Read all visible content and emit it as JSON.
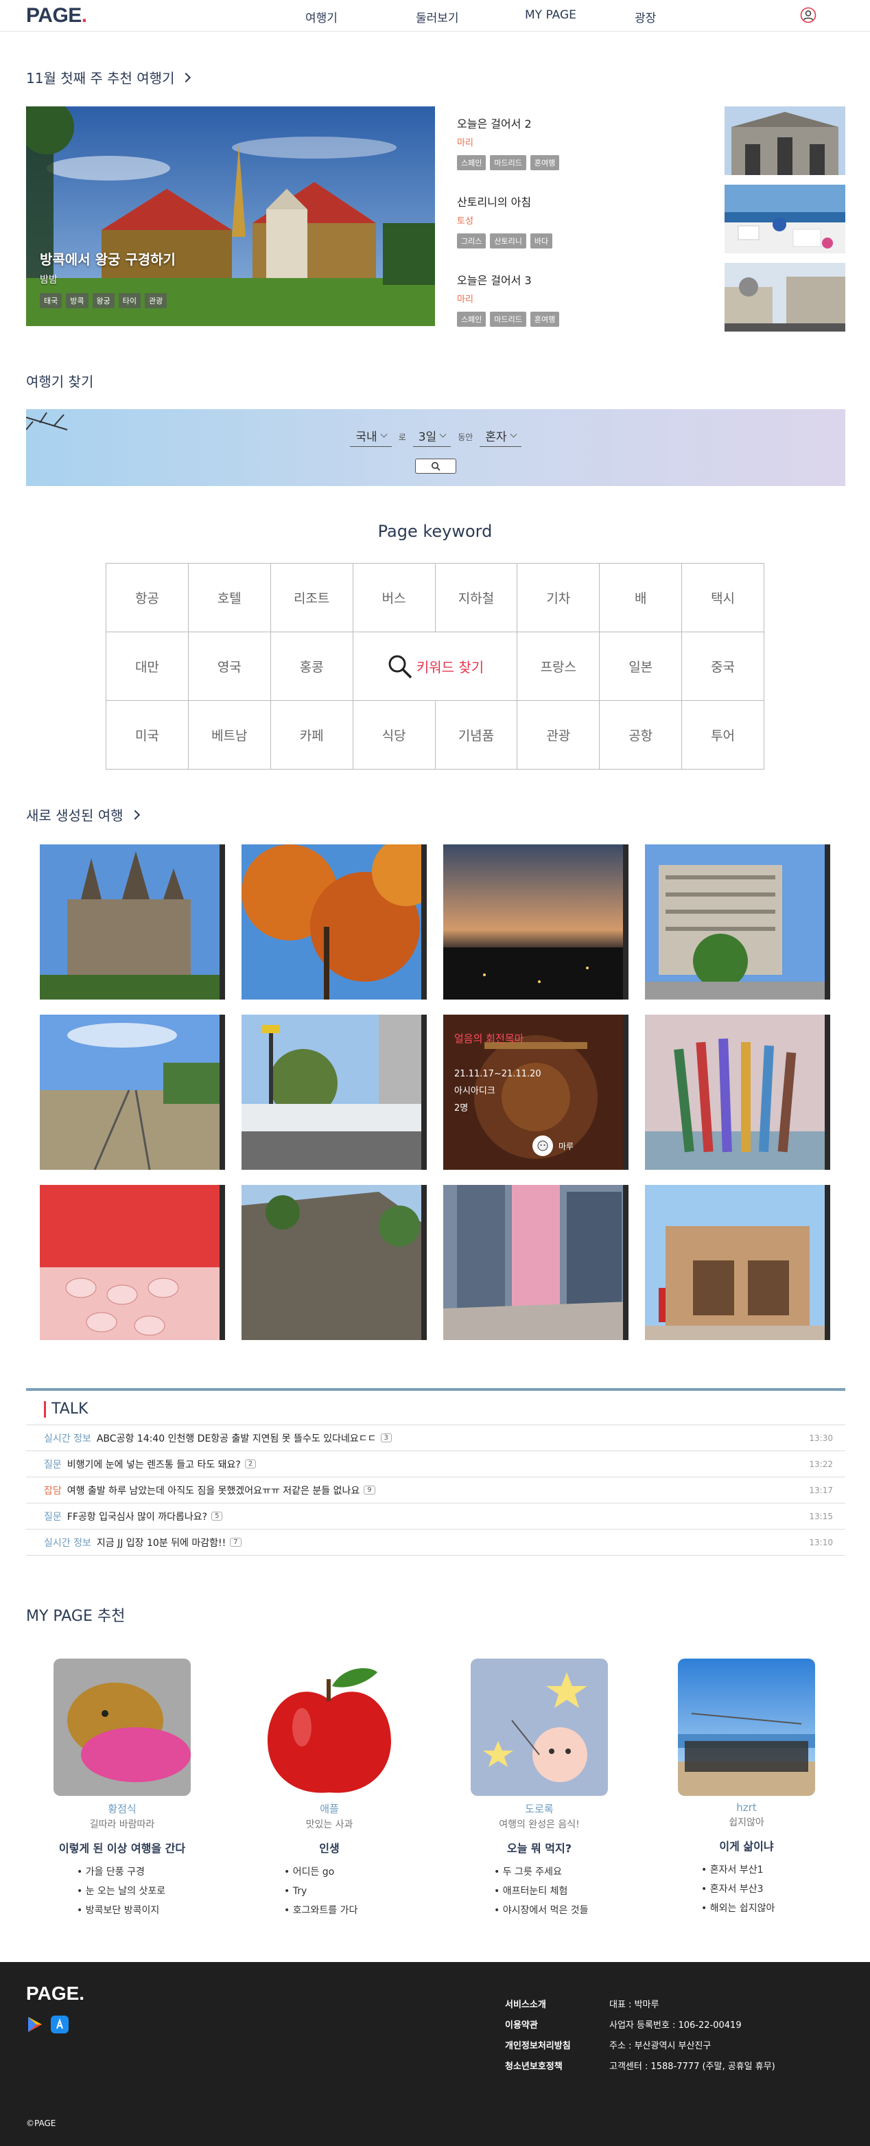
{
  "header": {
    "logo": "PAGE",
    "logo_dot": ".",
    "nav": [
      "여행기",
      "둘러보기",
      "MY PAGE",
      "광장"
    ]
  },
  "weekly": {
    "title": "11월 첫째 주 추천 여행기",
    "feature": {
      "title": "방콕에서 왕궁 구경하기",
      "author": "밤밤",
      "tags": [
        "태국",
        "방콕",
        "왕궁",
        "타이",
        "관광"
      ]
    },
    "items": [
      {
        "title": "오늘은 걸어서 2",
        "author": "마리",
        "tags": [
          "스페인",
          "마드리드",
          "혼여행"
        ]
      },
      {
        "title": "산토리니의 아침",
        "author": "토성",
        "tags": [
          "그리스",
          "산토리니",
          "바다"
        ]
      },
      {
        "title": "오늘은 걸어서 3",
        "author": "마리",
        "tags": [
          "스페인",
          "마드리드",
          "혼여행"
        ]
      }
    ]
  },
  "search": {
    "title": "여행기 찾기",
    "region": "국내",
    "region_suffix": "로",
    "duration": "3일",
    "duration_suffix": "동안",
    "companion": "혼자"
  },
  "keywords": {
    "title": "Page keyword",
    "row1": [
      "항공",
      "호텔",
      "리조트",
      "버스",
      "지하철",
      "기차",
      "배",
      "택시"
    ],
    "row2_left": [
      "대만",
      "영국",
      "홍콩"
    ],
    "center": "키워드 찾기",
    "row2_right": [
      "프랑스",
      "일본",
      "중국"
    ],
    "row3": [
      "미국",
      "베트남",
      "카페",
      "식당",
      "기념품",
      "관광",
      "공항",
      "투어"
    ]
  },
  "new_trips": {
    "title": "새로 생성된 여행",
    "hover": {
      "title": "얼음의 회전목마",
      "date": "21.11.17~21.11.20",
      "place": "아시아디크",
      "count": "2명",
      "author": "마루"
    }
  },
  "talk": {
    "title": "TALK",
    "rows": [
      {
        "cat": "실시간 정보",
        "text": "ABC공항 14:40 인천행 DE항공 출발 지연됨 못 뜰수도 있다네요ㄷㄷ",
        "count": "3",
        "time": "13:30"
      },
      {
        "cat": "질문",
        "text": "비행기에 눈에 넣는 렌즈통 들고 타도 돼요?",
        "count": "2",
        "time": "13:22"
      },
      {
        "cat": "잡담",
        "text": "여행 출발 하루 남았는데 아직도 짐을 못했겠어요ㅠㅠ 저같은 분들 없나요",
        "count": "9",
        "time": "13:17"
      },
      {
        "cat": "질문",
        "text": "FF공항 입국심사 많이 까다롭나요?",
        "count": "5",
        "time": "13:15"
      },
      {
        "cat": "실시간 정보",
        "text": "지금 JJ 입장 10분 뒤에 마감함!!",
        "count": "7",
        "time": "13:10"
      }
    ]
  },
  "mypage": {
    "title": "MY PAGE 추천",
    "cards": [
      {
        "name": "황점식",
        "sub": "길따라 바람따라",
        "head": "이렇게 된 이상 여행을 간다",
        "items": [
          "가을 단풍 구경",
          "눈 오는 날의 삿포로",
          "방콕보단 방콕이지"
        ]
      },
      {
        "name": "애플",
        "sub": "맛있는 사과",
        "head": "인생",
        "items": [
          "어디든 go",
          "Try",
          "호그와트를 가다"
        ]
      },
      {
        "name": "도로록",
        "sub": "여행의 완성은 음식!",
        "head": "오늘 뭐 먹지?",
        "items": [
          "두 그릇 주세요",
          "애프터눈티 체험",
          "야시장에서 먹은 것들"
        ]
      },
      {
        "name": "hzrt",
        "sub": "쉽지않아",
        "head": "이게 삶이냐",
        "items": [
          "혼자서 부산1",
          "혼자서 부산3",
          "해외는 쉽지않아"
        ]
      }
    ]
  },
  "footer": {
    "logo": "PAGE.",
    "links": [
      "서비스소개",
      "이용약관",
      "개인정보처리방침",
      "청소년보호정책"
    ],
    "info": [
      "대표 : 박마루",
      "사업자 등록번호 : 106-22-00419",
      "주소 : 부산광역시 부산진구",
      "고객센터 : 1588-7777 (주말, 공휴일 휴무)"
    ],
    "copyright": "©PAGE"
  },
  "colors": {
    "brand": "#2b3a55",
    "accent": "#e5364b",
    "link": "#6c9bc0"
  }
}
